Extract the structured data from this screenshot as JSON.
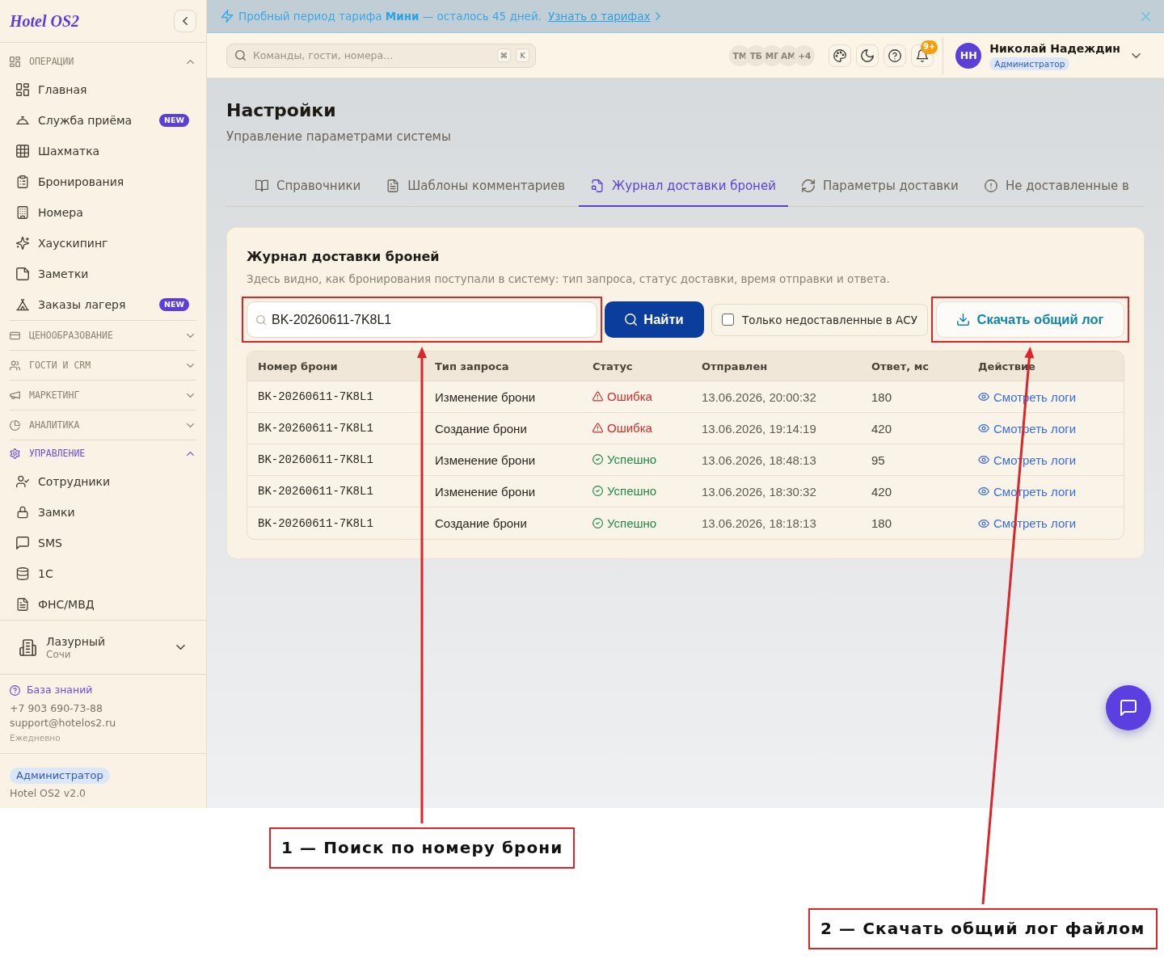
{
  "sidebar": {
    "logo": "Hotel OS2",
    "sections": [
      {
        "title": "ОПЕРАЦИИ",
        "expanded": true,
        "active": false,
        "items": [
          {
            "label": "Главная"
          },
          {
            "label": "Служба приёма",
            "badge": "NEW"
          },
          {
            "label": "Шахматка"
          },
          {
            "label": "Бронирования"
          },
          {
            "label": "Номера"
          },
          {
            "label": "Хаускипинг"
          },
          {
            "label": "Заметки"
          },
          {
            "label": "Заказы лагеря",
            "badge": "NEW"
          }
        ]
      },
      {
        "title": "ЦЕНООБРАЗОВАНИЕ",
        "expanded": false,
        "active": false
      },
      {
        "title": "ГОСТИ И CRM",
        "expanded": false,
        "active": false
      },
      {
        "title": "МАРКЕТИНГ",
        "expanded": false,
        "active": false
      },
      {
        "title": "АНАЛИТИКА",
        "expanded": false,
        "active": false
      },
      {
        "title": "УПРАВЛЕНИЕ",
        "expanded": true,
        "active": true,
        "items": [
          {
            "label": "Сотрудники"
          },
          {
            "label": "Замки"
          },
          {
            "label": "SMS"
          },
          {
            "label": "1С"
          },
          {
            "label": "ФНС/МВД"
          }
        ]
      }
    ],
    "property": {
      "name": "Лазурный",
      "city": "Сочи"
    },
    "support": {
      "link": "База знаний",
      "phone": "+7 903 690-73-88",
      "email": "support@hotelos2.ru",
      "hours": "Ежедневно"
    },
    "footer": {
      "role": "Администратор",
      "version": "Hotel OS2 v2.0"
    }
  },
  "banner": {
    "message": "Пробный период тарифа **Мини** — осталось 45 дней.",
    "link": "Узнать о тарифах"
  },
  "topbar": {
    "search": {
      "placeholder": "Команды, гости, номера...",
      "shortcut": [
        "⌘",
        "K"
      ]
    },
    "online_users": [
      "ТМ",
      "ТБ",
      "МГ",
      "АМ"
    ],
    "online_more": "+4",
    "notifications": "9+",
    "user": {
      "initials": "НН",
      "name": "Николай Надеждин",
      "role": "Администратор"
    }
  },
  "page": {
    "title": "Настройки",
    "subtitle": "Управление параметрами системы",
    "tabs": [
      {
        "label": "Справочники",
        "selected": false
      },
      {
        "label": "Шаблоны комментариев",
        "selected": false
      },
      {
        "label": "Журнал доставки броней",
        "selected": true
      },
      {
        "label": "Параметры доставки",
        "selected": false
      },
      {
        "label": "Не доставленные в",
        "selected": false
      }
    ]
  },
  "delivery_log": {
    "title": "Журнал доставки броней",
    "description": "Здесь видно, как бронирования поступали в систему: тип запроса, статус доставки, время отправки и ответа.",
    "search": {
      "value": "BK-20260611-7K8L1"
    },
    "search_button": "Найти",
    "filter": {
      "label": "Только недоставленные в АСУ",
      "checked": false
    },
    "download_button": "Скачать общий лог",
    "table": {
      "columns": [
        "Номер брони",
        "Тип запроса",
        "Статус",
        "Отправлен",
        "Ответ, мс",
        "Действие"
      ],
      "rows": [
        {
          "booking": "BK-20260611-7K8L1",
          "request_type": "Изменение брони",
          "status": {
            "text": "Ошибка",
            "kind": "error"
          },
          "sent": "13.06.2026, 20:00:32",
          "response_ms": "180",
          "action": "Смотреть логи"
        },
        {
          "booking": "BK-20260611-7K8L1",
          "request_type": "Создание брони",
          "status": {
            "text": "Ошибка",
            "kind": "error"
          },
          "sent": "13.06.2026, 19:14:19",
          "response_ms": "420",
          "action": "Смотреть логи"
        },
        {
          "booking": "BK-20260611-7K8L1",
          "request_type": "Изменение брони",
          "status": {
            "text": "Успешно",
            "kind": "success"
          },
          "sent": "13.06.2026, 18:48:13",
          "response_ms": "95",
          "action": "Смотреть логи"
        },
        {
          "booking": "BK-20260611-7K8L1",
          "request_type": "Изменение брони",
          "status": {
            "text": "Успешно",
            "kind": "success"
          },
          "sent": "13.06.2026, 18:30:32",
          "response_ms": "420",
          "action": "Смотреть логи"
        },
        {
          "booking": "BK-20260611-7K8L1",
          "request_type": "Создание брони",
          "status": {
            "text": "Успешно",
            "kind": "success"
          },
          "sent": "13.06.2026, 18:18:13",
          "response_ms": "180",
          "action": "Смотреть логи"
        }
      ]
    }
  },
  "annotations": [
    {
      "label": "1 — Поиск по номеру брони"
    },
    {
      "label": "2 — Скачать общий лог файлом"
    }
  ]
}
